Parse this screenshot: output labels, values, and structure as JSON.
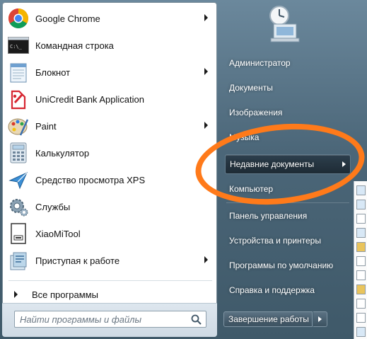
{
  "programs": [
    {
      "label": "Google Chrome",
      "icon": "chrome-icon",
      "has_submenu": true
    },
    {
      "label": "Командная строка",
      "icon": "cmd-icon",
      "has_submenu": false
    },
    {
      "label": "Блокнот",
      "icon": "notepad-icon",
      "has_submenu": true
    },
    {
      "label": "UniCredit Bank Application",
      "icon": "unicredit-icon",
      "has_submenu": false
    },
    {
      "label": "Paint",
      "icon": "paint-icon",
      "has_submenu": true
    },
    {
      "label": "Калькулятор",
      "icon": "calculator-icon",
      "has_submenu": false
    },
    {
      "label": "Средство просмотра XPS",
      "icon": "xps-viewer-icon",
      "has_submenu": false
    },
    {
      "label": "Службы",
      "icon": "services-gear-icon",
      "has_submenu": false
    },
    {
      "label": "XiaoMiTool",
      "icon": "xiaomitool-icon",
      "has_submenu": false
    },
    {
      "label": "Приступая к работе",
      "icon": "getting-started-icon",
      "has_submenu": true
    }
  ],
  "all_programs_label": "Все программы",
  "search": {
    "placeholder": "Найти программы и файлы"
  },
  "right_pane": [
    {
      "label": "Администратор"
    },
    {
      "label": "Документы"
    },
    {
      "label": "Изображения"
    },
    {
      "label": "Музыка"
    },
    {
      "label": "Недавние документы",
      "highlighted": true
    },
    {
      "label": "Компьютер"
    },
    {
      "label": "Панель управления"
    },
    {
      "label": "Устройства и принтеры"
    },
    {
      "label": "Программы по умолчанию"
    },
    {
      "label": "Справка и поддержка"
    }
  ],
  "shutdown_label": "Завершение работы",
  "colors": {
    "annotation": "#ff7a1a",
    "highlight_bg": "#1e2b35",
    "right_text": "#ffffff"
  }
}
